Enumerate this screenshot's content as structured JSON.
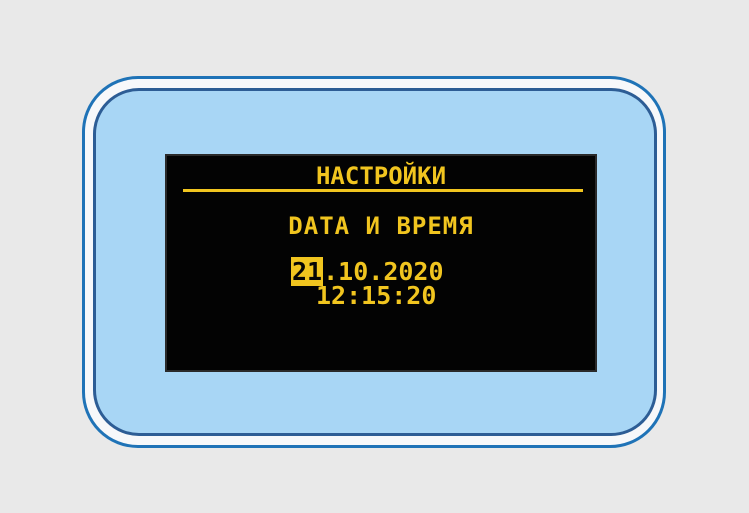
{
  "display": {
    "menu_title": "НАСТРОЙКИ",
    "setting_name": "DATA И ВРЕМЯ",
    "date": {
      "day": "21",
      "rest": ".10.2020"
    },
    "time": "12:15:20"
  },
  "colors": {
    "screen_background": "#030303",
    "lcd_text": "#f1c51f",
    "bezel_blue": "#a8d6f5",
    "outline_blue": "#1f73b7",
    "page_background": "#e9e9e9"
  }
}
